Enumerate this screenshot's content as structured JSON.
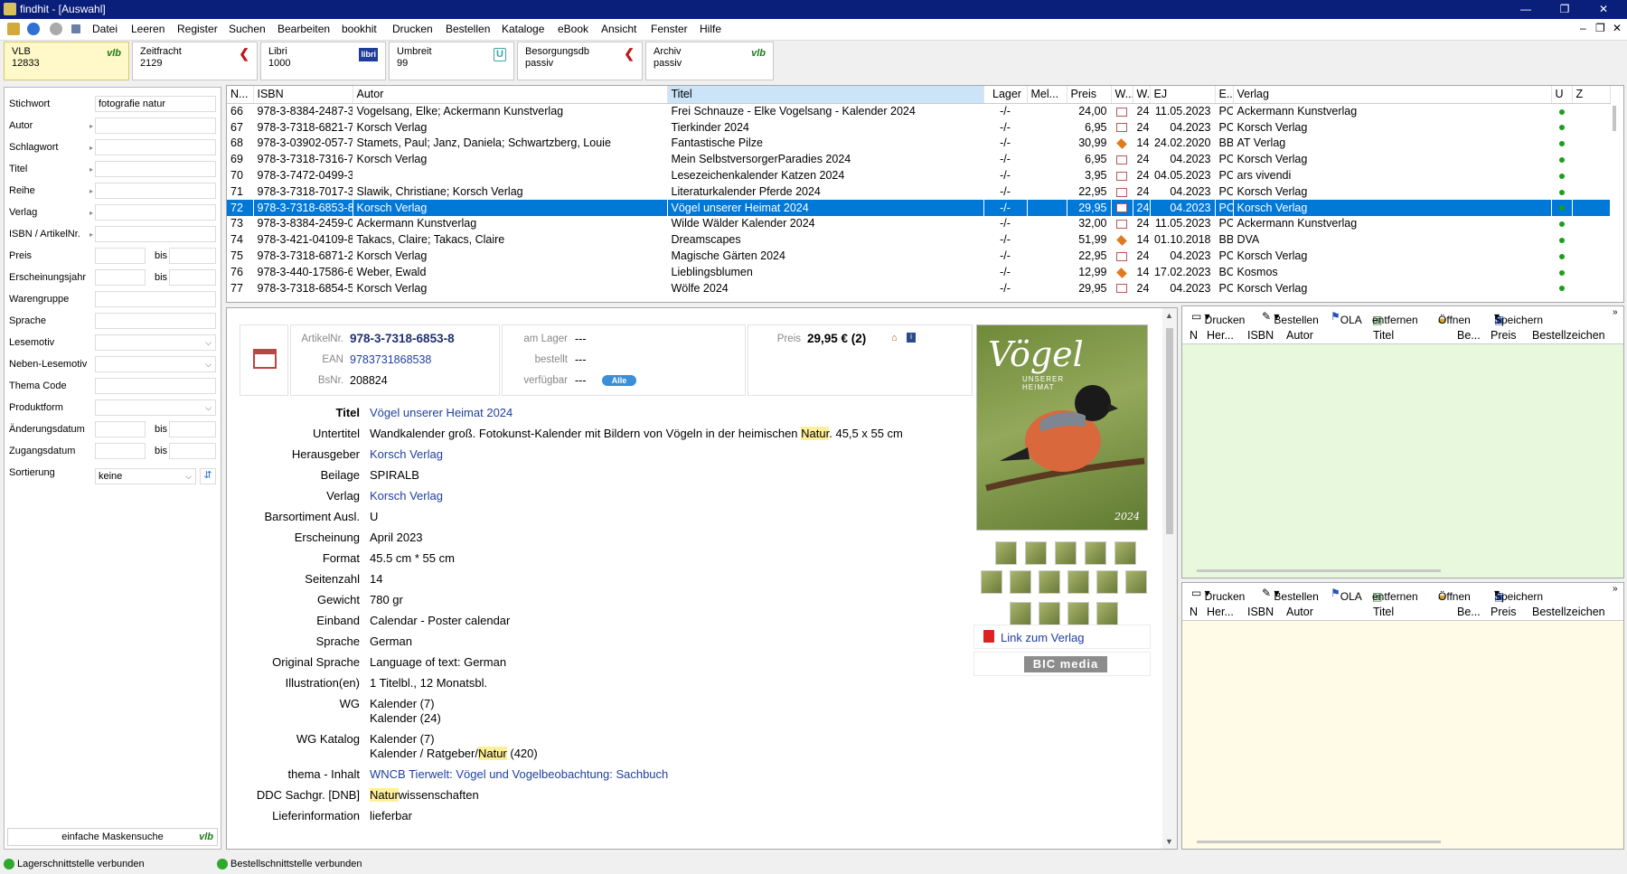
{
  "window": {
    "title": "findhit - [Auswahl]",
    "minimize": "—",
    "restore": "❐",
    "close": "✕"
  },
  "menu": [
    "Datei",
    "Leeren",
    "Register",
    "Suchen",
    "Bearbeiten",
    "bookhit",
    "Drucken",
    "Bestellen",
    "Kataloge",
    "eBook",
    "Ansicht",
    "Fenster",
    "Hilfe"
  ],
  "sources": [
    {
      "name": "VLB",
      "count": "12833",
      "mark": "vlb"
    },
    {
      "name": "Zeitfracht",
      "count": "2129",
      "mark": "❮"
    },
    {
      "name": "Libri",
      "count": "1000",
      "mark": "libri"
    },
    {
      "name": "Umbreit",
      "count": "99",
      "mark": "U"
    },
    {
      "name": "Besorgungsdb",
      "count": "passiv",
      "mark": "❮"
    },
    {
      "name": "Archiv",
      "count": "passiv",
      "mark": "vlb"
    }
  ],
  "search": {
    "stichwort_label": "Stichwort",
    "stichwort_value": "fotografie natur",
    "autor": "Autor",
    "schlagwort": "Schlagwort",
    "titel": "Titel",
    "reihe": "Reihe",
    "verlag": "Verlag",
    "isbn": "ISBN / ArtikelNr.",
    "preis": "Preis",
    "erscheinungsjahr": "Erscheinungsjahr",
    "warengruppe": "Warengruppe",
    "sprache": "Sprache",
    "lesemotiv": "Lesemotiv",
    "neben_lesemotiv": "Neben-Lesemotiv",
    "thema_code": "Thema Code",
    "produktform": "Produktform",
    "aenderungsdatum": "Änderungsdatum",
    "zugangsdatum": "Zugangsdatum",
    "sortierung": "Sortierung",
    "sortierung_value": "keine",
    "bis": "bis",
    "footer_button": "einfache Maskensuche",
    "footer_mark": "vlb"
  },
  "results": {
    "columns": [
      "N...",
      "ISBN",
      "Autor",
      "Titel",
      "Lager",
      "Mel...",
      "Preis",
      "W...",
      "W...",
      "EJ",
      "E...",
      "Verlag",
      "U",
      "Z"
    ],
    "rows": [
      {
        "n": "66",
        "isbn": "978-3-8384-2487-3",
        "autor": "Vogelsang, Elke; Ackermann Kunstverlag",
        "titel": "Frei Schnauze - Elke Vogelsang - Kalender 2024",
        "lager": "-/-",
        "preis": "24,00",
        "w": "24",
        "ej": "11.05.2023",
        "e": "PC",
        "verlag": "Ackermann Kunstverlag",
        "icon": "cal"
      },
      {
        "n": "67",
        "isbn": "978-3-7318-6821-7",
        "autor": "Korsch Verlag",
        "titel": "Tierkinder 2024",
        "lager": "-/-",
        "preis": "6,95",
        "w": "24",
        "ej": "04.2023",
        "e": "PC",
        "verlag": "Korsch Verlag",
        "icon": "cal"
      },
      {
        "n": "68",
        "isbn": "978-3-03902-057-7",
        "autor": "Stamets, Paul; Janz, Daniela; Schwartzberg, Louie",
        "titel": "Fantastische Pilze",
        "lager": "-/-",
        "preis": "30,99",
        "w": "14",
        "ej": "24.02.2020",
        "e": "BB",
        "verlag": "AT Verlag",
        "icon": "book"
      },
      {
        "n": "69",
        "isbn": "978-3-7318-7316-7",
        "autor": "Korsch Verlag",
        "titel": "Mein SelbstversorgerParadies 2024",
        "lager": "-/-",
        "preis": "6,95",
        "w": "24",
        "ej": "04.2023",
        "e": "PC",
        "verlag": "Korsch Verlag",
        "icon": "cal"
      },
      {
        "n": "70",
        "isbn": "978-3-7472-0499-3",
        "autor": "",
        "titel": "Lesezeichenkalender Katzen 2024",
        "lager": "-/-",
        "preis": "3,95",
        "w": "24",
        "ej": "04.05.2023",
        "e": "PC",
        "verlag": "ars vivendi",
        "icon": "cal"
      },
      {
        "n": "71",
        "isbn": "978-3-7318-7017-3",
        "autor": "Slawik, Christiane; Korsch Verlag",
        "titel": "Literaturkalender Pferde 2024",
        "lager": "-/-",
        "preis": "22,95",
        "w": "24",
        "ej": "04.2023",
        "e": "PC",
        "verlag": "Korsch Verlag",
        "icon": "cal"
      },
      {
        "n": "72",
        "isbn": "978-3-7318-6853-8",
        "autor": "Korsch Verlag",
        "titel": "Vögel unserer Heimat 2024",
        "lager": "-/-",
        "preis": "29,95",
        "w": "24",
        "ej": "04.2023",
        "e": "PC",
        "verlag": "Korsch Verlag",
        "icon": "cal",
        "selected": true
      },
      {
        "n": "73",
        "isbn": "978-3-8384-2459-0",
        "autor": "Ackermann Kunstverlag",
        "titel": "Wilde Wälder Kalender 2024",
        "lager": "-/-",
        "preis": "32,00",
        "w": "24",
        "ej": "11.05.2023",
        "e": "PC",
        "verlag": "Ackermann Kunstverlag",
        "icon": "cal"
      },
      {
        "n": "74",
        "isbn": "978-3-421-04109-8",
        "autor": "Takacs, Claire; Takacs, Claire",
        "titel": "Dreamscapes",
        "lager": "-/-",
        "preis": "51,99",
        "w": "14",
        "ej": "01.10.2018",
        "e": "BB",
        "verlag": "DVA",
        "icon": "book"
      },
      {
        "n": "75",
        "isbn": "978-3-7318-6871-2",
        "autor": "Korsch Verlag",
        "titel": "Magische Gärten 2024",
        "lager": "-/-",
        "preis": "22,95",
        "w": "24",
        "ej": "04.2023",
        "e": "PC",
        "verlag": "Korsch Verlag",
        "icon": "cal"
      },
      {
        "n": "76",
        "isbn": "978-3-440-17586-6",
        "autor": "Weber, Ewald",
        "titel": "Lieblingsblumen",
        "lager": "-/-",
        "preis": "12,99",
        "w": "14",
        "ej": "17.02.2023",
        "e": "BC",
        "verlag": "Kosmos",
        "icon": "book"
      },
      {
        "n": "77",
        "isbn": "978-3-7318-6854-5",
        "autor": "Korsch Verlag",
        "titel": "Wölfe 2024",
        "lager": "-/-",
        "preis": "29,95",
        "w": "24",
        "ej": "04.2023",
        "e": "PC",
        "verlag": "Korsch Verlag",
        "icon": "cal"
      }
    ]
  },
  "detail": {
    "artikelnr_label": "ArtikelNr.",
    "artikelnr": "978-3-7318-6853-8",
    "ean_label": "EAN",
    "ean": "9783731868538",
    "bsnr_label": "BsNr.",
    "bsnr": "208824",
    "am_lager_label": "am Lager",
    "am_lager": "---",
    "bestellt_label": "bestellt",
    "bestellt": "---",
    "verfuegbar_label": "verfügbar",
    "verfuegbar": "---",
    "alle_badge": "Alle",
    "preis_label": "Preis",
    "preis": "29,95 € (2)",
    "titel_label": "Titel",
    "titel": "Vögel unserer Heimat 2024",
    "untertitel_label": "Untertitel",
    "untertitel_a": "Wandkalender groß. Fotokunst-Kalender mit Bildern von Vögeln in der heimischen ",
    "untertitel_hl": "Natur",
    "untertitel_b": ". 45,5 x 55 cm",
    "herausgeber_label": "Herausgeber",
    "herausgeber": "Korsch Verlag",
    "beilage_label": "Beilage",
    "beilage": "SPIRALB",
    "verlag_label": "Verlag",
    "verlag": "Korsch Verlag",
    "barsortiment_label": "Barsortiment Ausl.",
    "barsortiment": "U",
    "erscheinung_label": "Erscheinung",
    "erscheinung": "April 2023",
    "format_label": "Format",
    "format": "45.5 cm * 55 cm",
    "seitenzahl_label": "Seitenzahl",
    "seitenzahl": "14",
    "gewicht_label": "Gewicht",
    "gewicht": "780 gr",
    "einband_label": "Einband",
    "einband": "Calendar - Poster calendar",
    "sprache_label": "Sprache",
    "sprache": "German",
    "orig_sprache_label": "Original Sprache",
    "orig_sprache": "Language of text: German",
    "illustration_label": "Illustration(en)",
    "illustration": "1 Titelbl., 12 Monatsbl.",
    "wg_label": "WG",
    "wg_1": "Kalender (7)",
    "wg_2": "Kalender (24)",
    "wg_katalog_label": "WG Katalog",
    "wg_katalog_1": "Kalender (7)",
    "wg_katalog_2a": "Kalender / Ratgeber/",
    "wg_katalog_2hl": "Natur",
    "wg_katalog_2b": " (420)",
    "thema_label": "thema - Inhalt",
    "thema": "WNCB Tierwelt: Vögel und Vogelbeobachtung: Sachbuch",
    "ddc_label": "DDC Sachgr. [DNB]",
    "ddc_hl": "Natur",
    "ddc_b": "wissenschaften",
    "liefer_label": "Lieferinformation",
    "liefer": "lieferbar",
    "cover_title": "Vögel",
    "cover_sub1": "UNSERER",
    "cover_sub2": "HEIMAT",
    "cover_year": "2024",
    "link_verlag": "Link zum Verlag",
    "bic": "BIC media"
  },
  "lists": {
    "toolbar": {
      "drucken": "Drucken",
      "bestellen": "Bestellen",
      "ola": "OLA",
      "entfernen": "entfernen",
      "oeffnen": "Öffnen",
      "speichern": "Speichern"
    },
    "columns": [
      "N",
      "Her...",
      "ISBN",
      "Autor",
      "Titel",
      "Be...",
      "Preis",
      "Bestellzeichen"
    ]
  },
  "status": {
    "lager": "Lagerschnittstelle verbunden",
    "bestell": "Bestellschnittstelle verbunden"
  },
  "colors": {
    "titlebar": "#0a1f7a",
    "selection": "#0078d7",
    "list1_bg": "#e8f8dc",
    "list2_bg": "#fffbe6",
    "highlight": "#ffef9a"
  }
}
